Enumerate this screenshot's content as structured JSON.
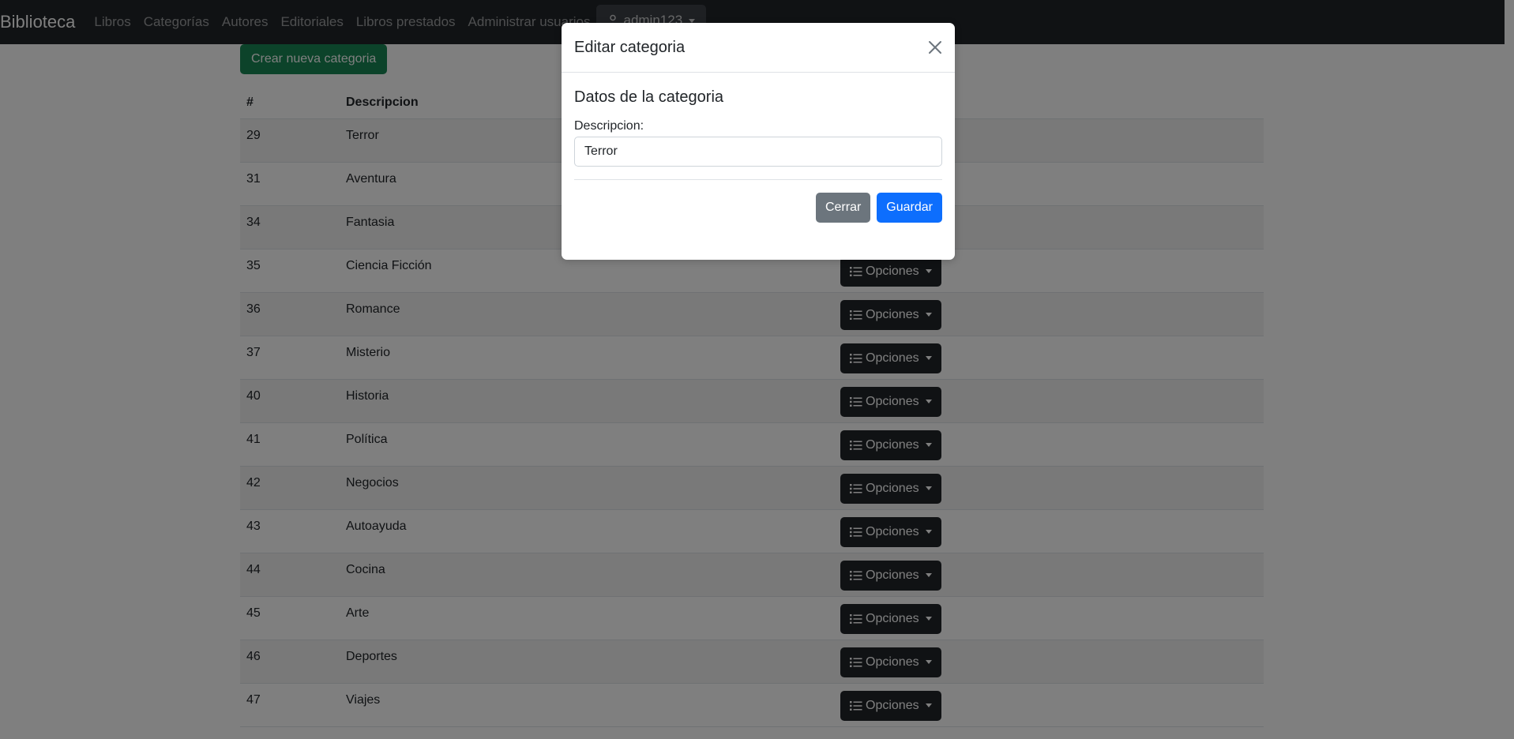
{
  "navbar": {
    "brand": "Biblioteca",
    "links": [
      "Libros",
      "Categorías",
      "Autores",
      "Editoriales",
      "Libros prestados",
      "Administrar usuarios"
    ],
    "user": "admin123"
  },
  "page": {
    "create_button": "Crear nueva categoria",
    "table_headers": [
      "#",
      "Descripcion"
    ],
    "options_label": "Opciones",
    "rows": [
      {
        "id": "29",
        "desc": "Terror"
      },
      {
        "id": "31",
        "desc": "Aventura"
      },
      {
        "id": "34",
        "desc": "Fantasia"
      },
      {
        "id": "35",
        "desc": "Ciencia Ficción"
      },
      {
        "id": "36",
        "desc": "Romance"
      },
      {
        "id": "37",
        "desc": "Misterio"
      },
      {
        "id": "40",
        "desc": "Historia"
      },
      {
        "id": "41",
        "desc": "Política"
      },
      {
        "id": "42",
        "desc": "Negocios"
      },
      {
        "id": "43",
        "desc": "Autoayuda"
      },
      {
        "id": "44",
        "desc": "Cocina"
      },
      {
        "id": "45",
        "desc": "Arte"
      },
      {
        "id": "46",
        "desc": "Deportes"
      },
      {
        "id": "47",
        "desc": "Viajes"
      }
    ]
  },
  "modal": {
    "title": "Editar categoria",
    "section_title": "Datos de la categoria",
    "field_label": "Descripcion:",
    "field_value": "Terror",
    "close_button": "Cerrar",
    "save_button": "Guardar"
  },
  "colors": {
    "navbar_bg": "#212529",
    "create_button": "#198754",
    "options_button": "#212529",
    "close_button": "#6c757d",
    "save_button": "#0d6efd"
  }
}
